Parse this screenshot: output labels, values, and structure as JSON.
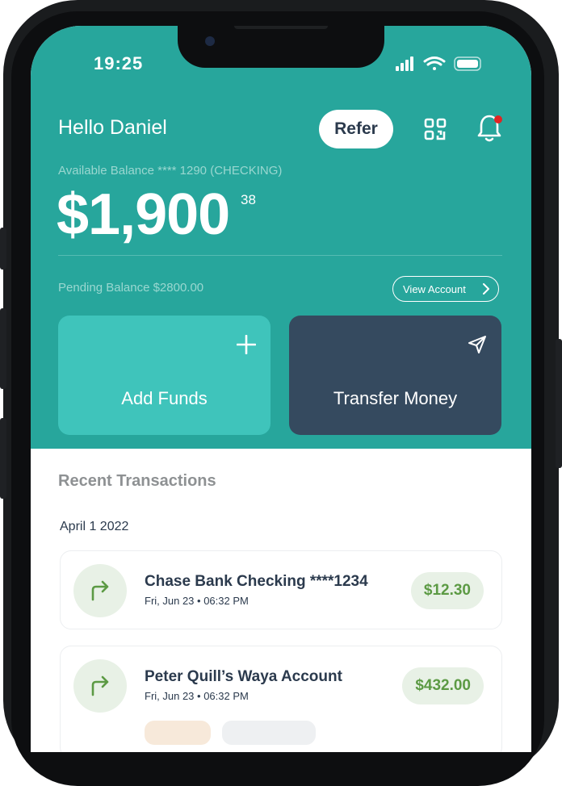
{
  "status_bar": {
    "time": "19:25"
  },
  "header": {
    "greeting": "Hello Daniel",
    "refer_label": "Refer",
    "qr_icon": "qr-code-icon",
    "bell_icon": "notification-bell-icon"
  },
  "balance": {
    "label": "Available Balance **** 1290 (CHECKING)",
    "amount": "$1,900",
    "cents": "38",
    "pending": "Pending Balance $2800.00",
    "view_account_label": "View Account"
  },
  "actions": {
    "add_funds_label": "Add Funds",
    "transfer_money_label": "Transfer Money"
  },
  "recent": {
    "heading": "Recent Transactions",
    "date": "April 1 2022",
    "items": [
      {
        "title": "Chase Bank Checking ****1234",
        "time": "Fri, Jun 23 • 06:32 PM",
        "amount": "$12.30"
      },
      {
        "title": "Peter Quill’s Waya Account",
        "time": "Fri, Jun 23 • 06:32 PM",
        "amount": "$432.00"
      }
    ]
  },
  "colors": {
    "hero": "#27a69c",
    "add_card": "#3fc4bb",
    "transfer_card": "#354a5f",
    "amount_green": "#5c9a44",
    "notification_dot": "#e02424"
  }
}
